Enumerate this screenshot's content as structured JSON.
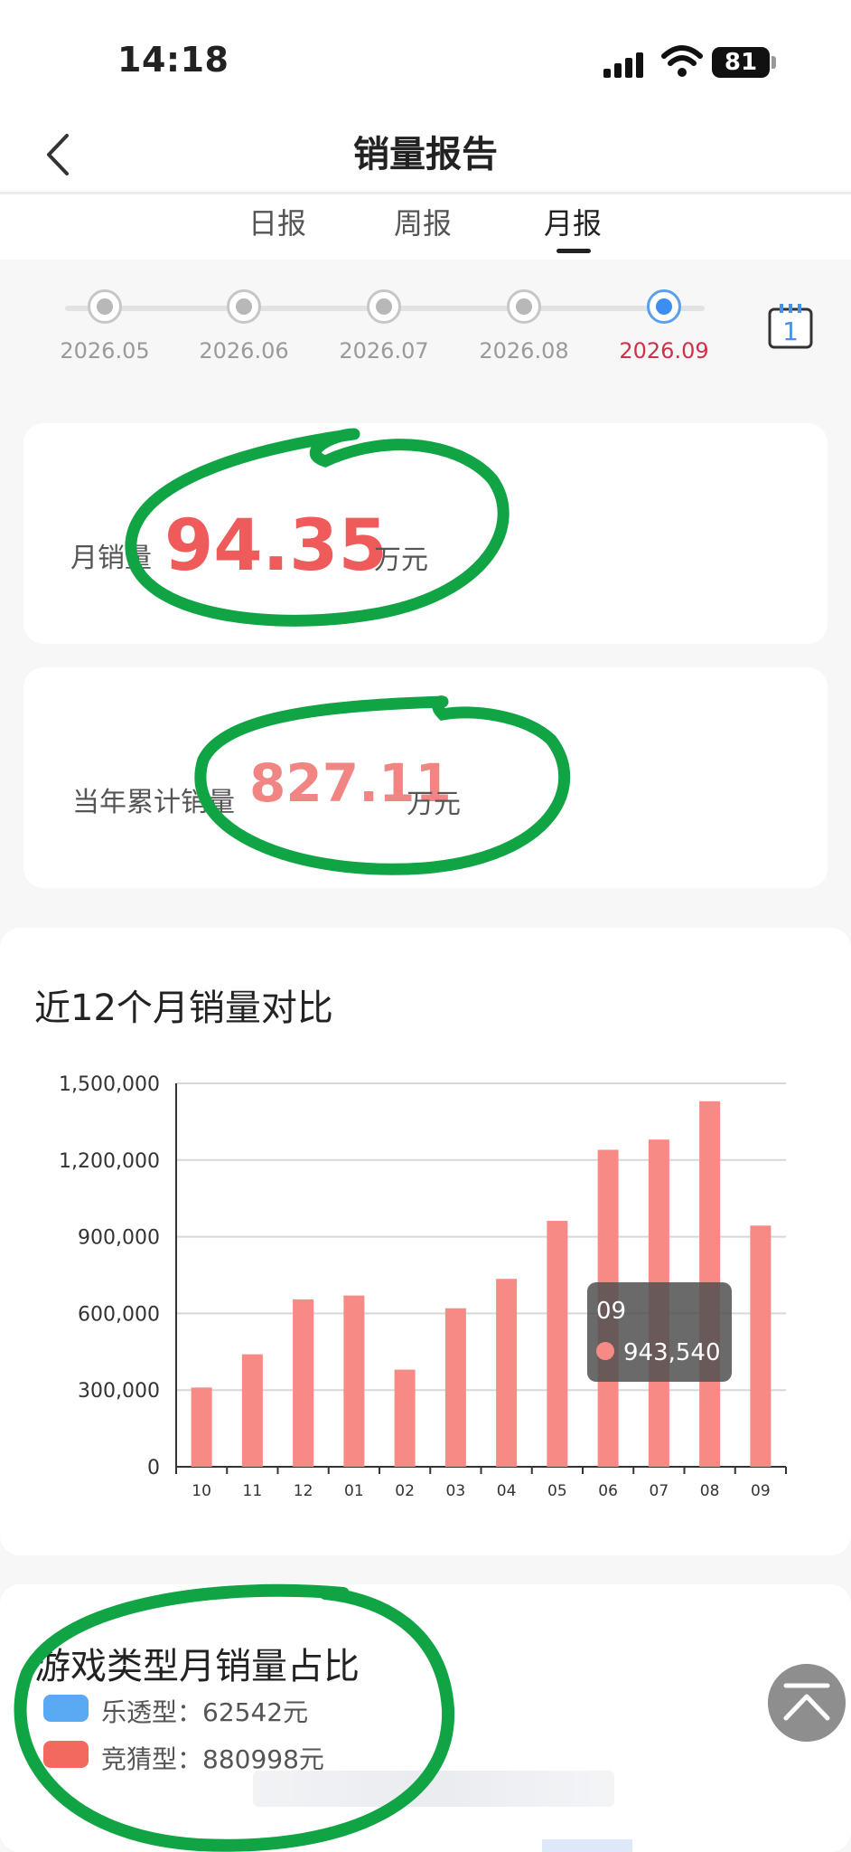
{
  "status_bar": {
    "time": "14:18",
    "battery": "81"
  },
  "nav": {
    "title": "销量报告"
  },
  "tabs": [
    {
      "label": "日报"
    },
    {
      "label": "周报"
    },
    {
      "label": "月报"
    }
  ],
  "timeline": {
    "months": [
      "2026.05",
      "2026.06",
      "2026.07",
      "2026.08",
      "2026.09"
    ],
    "selected": "2026.09",
    "calendar_day": "1"
  },
  "monthly_card": {
    "label": "月销量",
    "value": "94.35",
    "unit": "万元"
  },
  "yearly_card": {
    "label": "当年累计销量",
    "value": "827.11",
    "unit": "万元"
  },
  "chart_section": {
    "title": "近12个月销量对比"
  },
  "chart_data": {
    "type": "bar",
    "categories": [
      "10",
      "11",
      "12",
      "01",
      "02",
      "03",
      "04",
      "05",
      "06",
      "07",
      "08",
      "09"
    ],
    "values": [
      310000,
      440000,
      655000,
      670000,
      380000,
      620000,
      735000,
      962000,
      1240000,
      1280000,
      1430000,
      943540
    ],
    "ylim": [
      0,
      1500000
    ],
    "yticks": [
      0,
      300000,
      600000,
      900000,
      1200000,
      1500000
    ],
    "ytick_labels": [
      "0",
      "300,000",
      "600,000",
      "900,000",
      "1,200,000",
      "1,500,000"
    ],
    "grid": true,
    "bar_color": "#f88a86",
    "tooltip": {
      "category": "09",
      "value_label": "943,540"
    }
  },
  "share_section": {
    "title": "游戏类型月销量占比",
    "items": [
      {
        "label": "乐透型：62542元",
        "color": "#5aa9f3"
      },
      {
        "label": "竞猜型：880998元",
        "color": "#f4695f"
      }
    ]
  },
  "icons": {
    "back": "chevron-left-icon",
    "calendar": "calendar-icon",
    "scroll_top": "arrow-up-to-top-icon"
  }
}
